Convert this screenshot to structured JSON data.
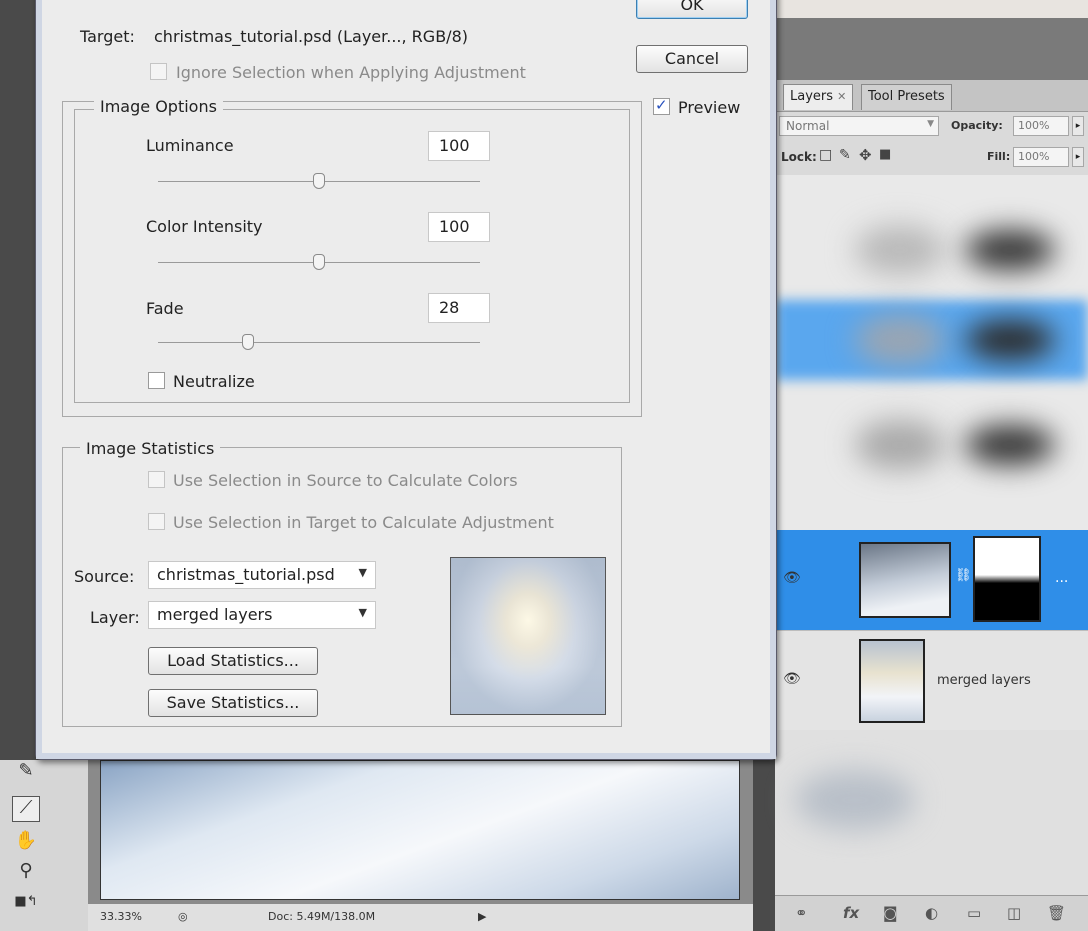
{
  "dialog": {
    "target_label": "Target:",
    "target_value": "christmas_tutorial.psd (Layer..., RGB/8)",
    "ignore_selection_label": "Ignore Selection when Applying Adjustment",
    "ok_label": "OK",
    "cancel_label": "Cancel",
    "preview_label": "Preview",
    "preview_checked": true,
    "image_options": {
      "legend": "Image Options",
      "luminance_label": "Luminance",
      "luminance_value": "100",
      "luminance_fraction": 0.5,
      "color_intensity_label": "Color Intensity",
      "color_intensity_value": "100",
      "color_intensity_fraction": 0.5,
      "fade_label": "Fade",
      "fade_value": "28",
      "fade_fraction": 0.28,
      "neutralize_label": "Neutralize"
    },
    "image_statistics": {
      "legend": "Image Statistics",
      "use_source_label": "Use Selection in Source to Calculate Colors",
      "use_target_label": "Use Selection in Target to Calculate Adjustment",
      "source_label": "Source:",
      "source_value": "christmas_tutorial.psd",
      "layer_label": "Layer:",
      "layer_value": "merged layers",
      "load_label": "Load Statistics...",
      "save_label": "Save Statistics..."
    }
  },
  "layers_panel": {
    "tab_layers": "Layers",
    "tab_tool_presets": "Tool Presets",
    "blend_mode": "Normal",
    "opacity_label": "Opacity:",
    "opacity_value": "100%",
    "lock_label": "Lock:",
    "fill_label": "Fill:",
    "fill_value": "100%",
    "layer_selected_more": "...",
    "layer_merged_name": "merged layers",
    "selection_color": "#2f8ee8"
  },
  "status_bar": {
    "zoom": "33.33%",
    "doc_size": "Doc: 5.49M/138.0M"
  }
}
